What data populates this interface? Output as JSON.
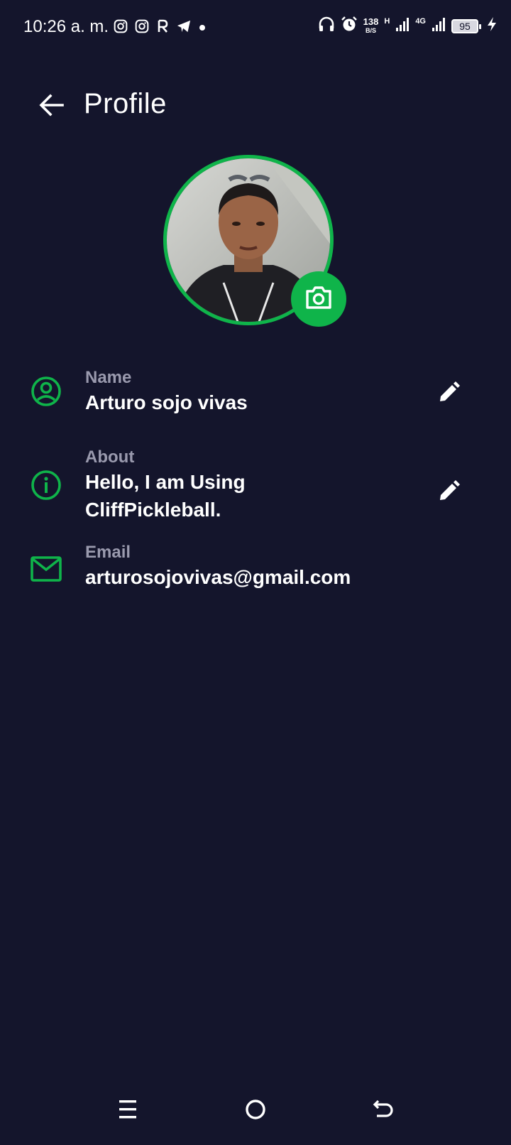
{
  "status_bar": {
    "time": "10:26 a. m.",
    "left_icons": [
      "instagram-icon",
      "instagram-icon",
      "r-app-icon",
      "telegram-icon",
      "dot-icon"
    ],
    "right_icons": [
      "headphones-icon",
      "alarm-icon",
      "signal-icon",
      "signal-icon",
      "charging-icon"
    ],
    "net_speed_value": "138",
    "net_speed_unit": "B/S",
    "network_h": "H",
    "network_4g": "4G",
    "battery_level": "95"
  },
  "header": {
    "title": "Profile",
    "back_icon": "arrow-left-icon"
  },
  "avatar": {
    "accent_color": "#0fb44a",
    "camera_icon": "camera-icon"
  },
  "fields": {
    "name": {
      "label": "Name",
      "value": "Arturo sojo vivas",
      "icon": "account-circle-icon",
      "editable": true
    },
    "about": {
      "label": "About",
      "value_line1": "Hello, I am Using",
      "value_line2": "CliffPickleball.",
      "icon": "info-icon",
      "editable": true
    },
    "email": {
      "label": "Email",
      "value": "arturosojovivas@gmail.com",
      "icon": "mail-icon",
      "editable": false
    }
  },
  "nav_bar": {
    "items": [
      "menu-icon",
      "home-icon",
      "back-icon"
    ]
  },
  "colors": {
    "background": "#14152c",
    "accent": "#0fb44a",
    "label_gray": "#9a9aae"
  }
}
